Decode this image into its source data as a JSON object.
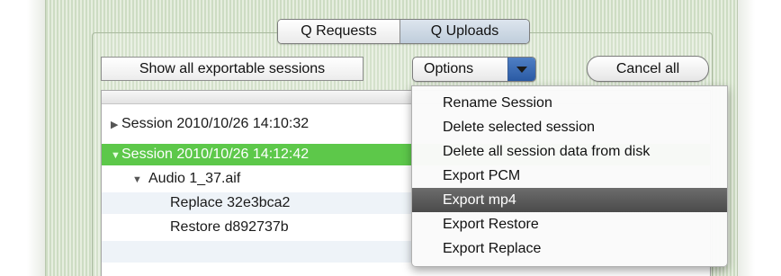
{
  "tabs": [
    {
      "label": "Q Requests",
      "selected": false
    },
    {
      "label": "Q Uploads",
      "selected": true
    }
  ],
  "toolbar": {
    "show_all_label": "Show all exportable sessions",
    "options_label": "Options",
    "cancel_all_label": "Cancel all"
  },
  "outline": {
    "rows": [
      {
        "label": "Session 2010/10/26 14:10:32",
        "level": 0,
        "disclosure": "▶",
        "selected": false
      },
      {
        "label": "Session 2010/10/26 14:12:42",
        "level": 0,
        "disclosure": "▼",
        "selected": true
      },
      {
        "label": "Audio 1_37.aif",
        "level": 1,
        "disclosure": "▼",
        "selected": false
      },
      {
        "label": "Replace 32e3bca2",
        "level": 2,
        "disclosure": "",
        "selected": false
      },
      {
        "label": "Restore d892737b",
        "level": 2,
        "disclosure": "",
        "selected": false
      }
    ]
  },
  "options_menu": {
    "items": [
      {
        "label": "Rename Session",
        "highlighted": false
      },
      {
        "label": "Delete selected session",
        "highlighted": false
      },
      {
        "label": "Delete all session data from disk",
        "highlighted": false
      },
      {
        "label": "Export PCM",
        "highlighted": false
      },
      {
        "label": "Export mp4",
        "highlighted": true
      },
      {
        "label": "Export Restore",
        "highlighted": false
      },
      {
        "label": "Export Replace",
        "highlighted": false
      }
    ]
  },
  "colors": {
    "selected_row": "#5dc84a",
    "menu_highlight": "#555555",
    "popup_arrow": "#3a68b0"
  },
  "icons": {
    "collapsed": "disclosure-right-icon",
    "expanded": "disclosure-down-icon",
    "popup": "chevron-down-icon"
  }
}
